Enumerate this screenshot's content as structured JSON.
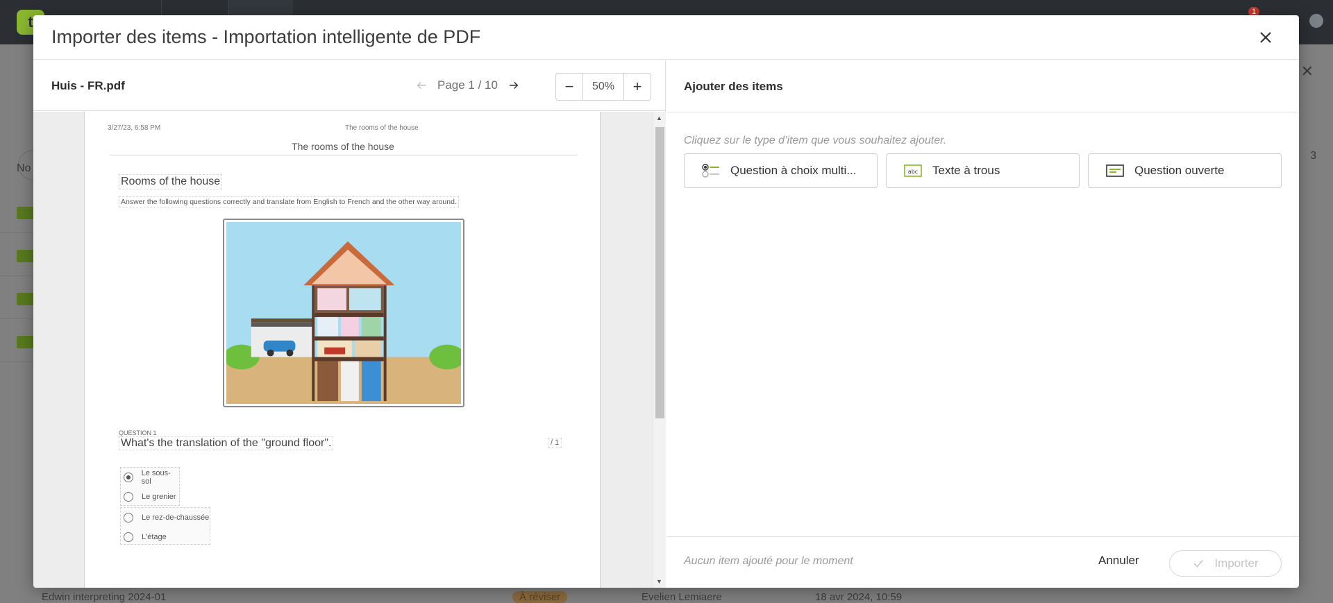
{
  "background": {
    "notification_count": "1",
    "side_label": "No",
    "count_badge": "3",
    "bottom_row": {
      "name": "Edwin interpreting 2024-01",
      "status": "À réviser",
      "owner": "Evelien Lemiaere",
      "date": "18 avr 2024, 10:59"
    }
  },
  "modal": {
    "title": "Importer des items - Importation intelligente de PDF"
  },
  "pdf": {
    "file_name": "Huis - FR.pdf",
    "page_label": "Page 1 / 10",
    "zoom_value": "50%",
    "zoom_out": "−",
    "zoom_in": "+",
    "page": {
      "date": "3/27/23, 6:58 PM",
      "header_center": "The rooms of the house",
      "title": "The rooms of the house",
      "heading": "Rooms of the house",
      "instructions": "Answer the following questions correctly and translate from English to French and the other way around.",
      "question_label": "QUESTION 1",
      "question_text": "What's the translation of the \"ground floor\".",
      "question_points": "/ 1",
      "options": [
        {
          "label": "Le sous-sol",
          "selected": true
        },
        {
          "label": "Le grenier",
          "selected": false
        },
        {
          "label": "Le rez-de-chaussée",
          "selected": false
        },
        {
          "label": "L'étage",
          "selected": false
        }
      ]
    }
  },
  "add_items": {
    "title": "Ajouter des items",
    "hint": "Cliquez sur le type d’item que vous souhaitez ajouter.",
    "types": [
      {
        "label": "Question à choix multi...",
        "icon": "multiple-choice-icon"
      },
      {
        "label": "Texte à trous",
        "icon": "fill-in-blank-icon"
      },
      {
        "label": "Question ouverte",
        "icon": "open-question-icon"
      }
    ],
    "footer_status": "Aucun item ajouté pour le moment",
    "cancel_label": "Annuler",
    "import_label": "Importer"
  },
  "colors": {
    "accent_green": "#8ab72f",
    "topbar": "#2b2f33",
    "disabled_text": "#c4c4c4"
  }
}
